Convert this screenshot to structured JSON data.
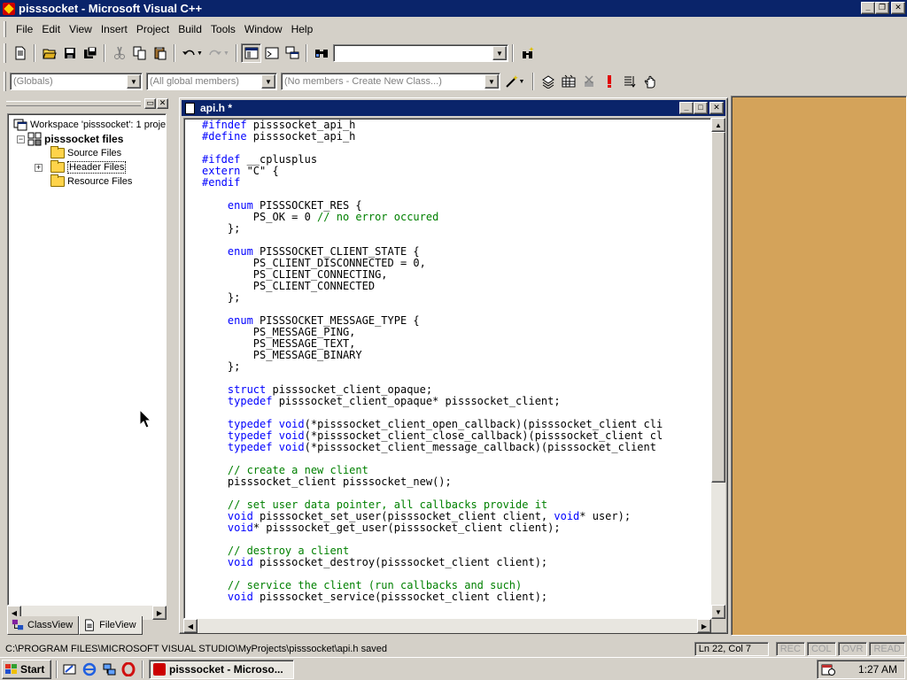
{
  "window": {
    "title": "pisssocket - Microsoft Visual C++",
    "min_label": "_",
    "restore_label": "❐",
    "close_label": "✕"
  },
  "menu": [
    {
      "label": "File"
    },
    {
      "label": "Edit"
    },
    {
      "label": "View"
    },
    {
      "label": "Insert"
    },
    {
      "label": "Project"
    },
    {
      "label": "Build"
    },
    {
      "label": "Tools"
    },
    {
      "label": "Window"
    },
    {
      "label": "Help"
    }
  ],
  "toolbar": {
    "find_combo_value": "",
    "wizard": {
      "globals": "(Globals)",
      "members": "(All global members)",
      "class_members": "(No members - Create New Class...)"
    }
  },
  "workspace": {
    "tree": {
      "root": "Workspace 'pisssocket': 1 proje",
      "project": "pisssocket files",
      "folders": [
        {
          "label": "Source Files",
          "expandable": false
        },
        {
          "label": "Header Files",
          "expandable": true,
          "expander": "+"
        },
        {
          "label": "Resource Files",
          "expandable": false
        }
      ]
    },
    "tabs": [
      {
        "label": "ClassView",
        "active": false
      },
      {
        "label": "FileView",
        "active": true
      }
    ]
  },
  "editor": {
    "title": "api.h *",
    "lines": [
      [
        [
          "kw",
          "#ifndef"
        ],
        [
          "t",
          " pisssocket_api_h"
        ]
      ],
      [
        [
          "kw",
          "#define"
        ],
        [
          "t",
          " pisssocket_api_h"
        ]
      ],
      [],
      [
        [
          "kw",
          "#ifdef"
        ],
        [
          "t",
          " __cplusplus"
        ]
      ],
      [
        [
          "kw",
          "extern"
        ],
        [
          "t",
          " \"C\" {"
        ]
      ],
      [
        [
          "kw",
          "#endif"
        ]
      ],
      [],
      [
        [
          "t",
          "    "
        ],
        [
          "kw",
          "enum"
        ],
        [
          "t",
          " PISSSOCKET_RES {"
        ]
      ],
      [
        [
          "t",
          "        PS_OK = 0 "
        ],
        [
          "cm",
          "// no error occured"
        ]
      ],
      [
        [
          "t",
          "    };"
        ]
      ],
      [],
      [
        [
          "t",
          "    "
        ],
        [
          "kw",
          "enum"
        ],
        [
          "t",
          " PISSSOCKET_CLIENT_STATE {"
        ]
      ],
      [
        [
          "t",
          "        PS_CLIENT_DISCONNECTED = 0,"
        ]
      ],
      [
        [
          "t",
          "        PS_CLIENT_CONNECTING,"
        ]
      ],
      [
        [
          "t",
          "        PS_CLIENT_CONNECTED"
        ]
      ],
      [
        [
          "t",
          "    };"
        ]
      ],
      [],
      [
        [
          "t",
          "    "
        ],
        [
          "kw",
          "enum"
        ],
        [
          "t",
          " PISSSOCKET_MESSAGE_TYPE {"
        ]
      ],
      [
        [
          "t",
          "        PS_MESSAGE_PING,"
        ]
      ],
      [
        [
          "t",
          "        PS_MESSAGE_TEXT,"
        ]
      ],
      [
        [
          "t",
          "        PS_MESSAGE_BINARY"
        ]
      ],
      [
        [
          "t",
          "    };"
        ]
      ],
      [],
      [
        [
          "t",
          "    "
        ],
        [
          "kw",
          "struct"
        ],
        [
          "t",
          " pisssocket_client_opaque;"
        ]
      ],
      [
        [
          "t",
          "    "
        ],
        [
          "kw",
          "typedef"
        ],
        [
          "t",
          " pisssocket_client_opaque* pisssocket_client;"
        ]
      ],
      [],
      [
        [
          "t",
          "    "
        ],
        [
          "kw",
          "typedef"
        ],
        [
          "t",
          " "
        ],
        [
          "kw",
          "void"
        ],
        [
          "t",
          "(*pisssocket_client_open_callback)(pisssocket_client cli"
        ]
      ],
      [
        [
          "t",
          "    "
        ],
        [
          "kw",
          "typedef"
        ],
        [
          "t",
          " "
        ],
        [
          "kw",
          "void"
        ],
        [
          "t",
          "(*pisssocket_client_close_callback)(pisssocket_client cl"
        ]
      ],
      [
        [
          "t",
          "    "
        ],
        [
          "kw",
          "typedef"
        ],
        [
          "t",
          " "
        ],
        [
          "kw",
          "void"
        ],
        [
          "t",
          "(*pisssocket_client_message_callback)(pisssocket_client"
        ]
      ],
      [],
      [
        [
          "t",
          "    "
        ],
        [
          "cm",
          "// create a new client"
        ]
      ],
      [
        [
          "t",
          "    pisssocket_client pisssocket_new();"
        ]
      ],
      [],
      [
        [
          "t",
          "    "
        ],
        [
          "cm",
          "// set user data pointer, all callbacks provide it"
        ]
      ],
      [
        [
          "t",
          "    "
        ],
        [
          "kw",
          "void"
        ],
        [
          "t",
          " pisssocket_set_user(pisssocket_client client, "
        ],
        [
          "kw",
          "void"
        ],
        [
          "t",
          "* user);"
        ]
      ],
      [
        [
          "t",
          "    "
        ],
        [
          "kw",
          "void"
        ],
        [
          "t",
          "* pisssocket_get_user(pisssocket_client client);"
        ]
      ],
      [],
      [
        [
          "t",
          "    "
        ],
        [
          "cm",
          "// destroy a client"
        ]
      ],
      [
        [
          "t",
          "    "
        ],
        [
          "kw",
          "void"
        ],
        [
          "t",
          " pisssocket_destroy(pisssocket_client client);"
        ]
      ],
      [],
      [
        [
          "t",
          "    "
        ],
        [
          "cm",
          "// service the client (run callbacks and such)"
        ]
      ],
      [
        [
          "t",
          "    "
        ],
        [
          "kw",
          "void"
        ],
        [
          "t",
          " pisssocket_service(pisssocket_client client);"
        ]
      ]
    ]
  },
  "statusbar": {
    "message": "C:\\PROGRAM FILES\\MICROSOFT VISUAL STUDIO\\MyProjects\\pisssocket\\api.h saved",
    "position": "Ln 22, Col 7",
    "indicators": [
      "REC",
      "COL",
      "OVR",
      "READ"
    ]
  },
  "taskbar": {
    "start_label": "Start",
    "task_label": "pisssocket - Microso...",
    "clock": "1:27 AM"
  },
  "colors": {
    "keyword": "#0000ff",
    "comment": "#008000",
    "titlebar": "#0a246a",
    "mdi_background": "#d4a35a"
  }
}
